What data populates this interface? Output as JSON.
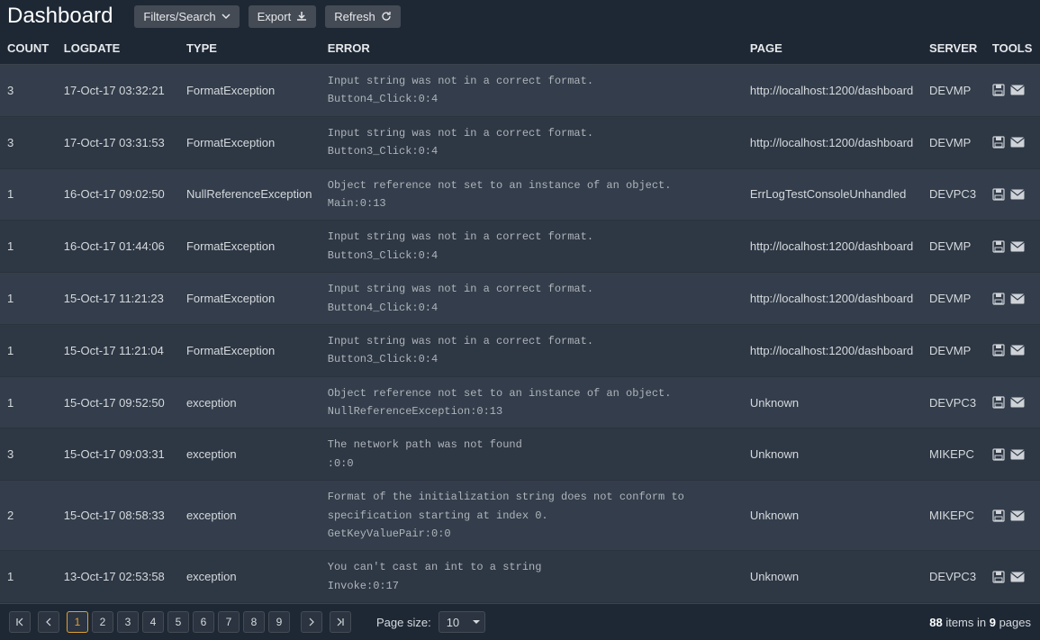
{
  "title": "Dashboard",
  "toolbar": {
    "filters_label": "Filters/Search",
    "export_label": "Export",
    "refresh_label": "Refresh"
  },
  "columns": {
    "count": "COUNT",
    "logdate": "LOGDATE",
    "type": "TYPE",
    "error": "ERROR",
    "page": "PAGE",
    "server": "SERVER",
    "tools": "TOOLS"
  },
  "rows": [
    {
      "count": "3",
      "logdate": "17-Oct-17 03:32:21",
      "type": "FormatException",
      "err1": "Input string was not in a correct format.",
      "err2": "Button4_Click:0:4",
      "err3": "",
      "page": "http://localhost:1200/dashboard",
      "server": "DEVMP"
    },
    {
      "count": "3",
      "logdate": "17-Oct-17 03:31:53",
      "type": "FormatException",
      "err1": "Input string was not in a correct format.",
      "err2": "Button3_Click:0:4",
      "err3": "",
      "page": "http://localhost:1200/dashboard",
      "server": "DEVMP"
    },
    {
      "count": "1",
      "logdate": "16-Oct-17 09:02:50",
      "type": "NullReferenceException",
      "err1": "Object reference not set to an instance of an object.",
      "err2": "Main:0:13",
      "err3": "",
      "page": "ErrLogTestConsoleUnhandled",
      "server": "DEVPC3"
    },
    {
      "count": "1",
      "logdate": "16-Oct-17 01:44:06",
      "type": "FormatException",
      "err1": "Input string was not in a correct format.",
      "err2": "Button3_Click:0:4",
      "err3": "",
      "page": "http://localhost:1200/dashboard",
      "server": "DEVMP"
    },
    {
      "count": "1",
      "logdate": "15-Oct-17 11:21:23",
      "type": "FormatException",
      "err1": "Input string was not in a correct format.",
      "err2": "Button4_Click:0:4",
      "err3": "",
      "page": "http://localhost:1200/dashboard",
      "server": "DEVMP"
    },
    {
      "count": "1",
      "logdate": "15-Oct-17 11:21:04",
      "type": "FormatException",
      "err1": "Input string was not in a correct format.",
      "err2": "Button3_Click:0:4",
      "err3": "",
      "page": "http://localhost:1200/dashboard",
      "server": "DEVMP"
    },
    {
      "count": "1",
      "logdate": "15-Oct-17 09:52:50",
      "type": "exception",
      "err1": "Object reference not set to an instance of an object.",
      "err2": "NullReferenceException:0:13",
      "err3": "",
      "page": "Unknown",
      "server": "DEVPC3"
    },
    {
      "count": "3",
      "logdate": "15-Oct-17 09:03:31",
      "type": "exception",
      "err1": "The network path was not found",
      "err2": ":0:0",
      "err3": "",
      "page": "Unknown",
      "server": "MIKEPC"
    },
    {
      "count": "2",
      "logdate": "15-Oct-17 08:58:33",
      "type": "exception",
      "err1": "Format of the initialization string does not conform to specification starting at index 0.",
      "err2": "GetKeyValuePair:0:0",
      "err3": "",
      "page": "Unknown",
      "server": "MIKEPC"
    },
    {
      "count": "1",
      "logdate": "13-Oct-17 02:53:58",
      "type": "exception",
      "err1": "You can't cast an int to a string",
      "err2": "Invoke:0:17",
      "err3": "",
      "page": "Unknown",
      "server": "DEVPC3"
    }
  ],
  "pager": {
    "pages": [
      "1",
      "2",
      "3",
      "4",
      "5",
      "6",
      "7",
      "8",
      "9"
    ],
    "current": "1",
    "page_size_label": "Page size:",
    "page_size_value": "10",
    "summary_items": "88",
    "summary_pages": "9",
    "summary_text1": " items in ",
    "summary_text2": " pages"
  }
}
